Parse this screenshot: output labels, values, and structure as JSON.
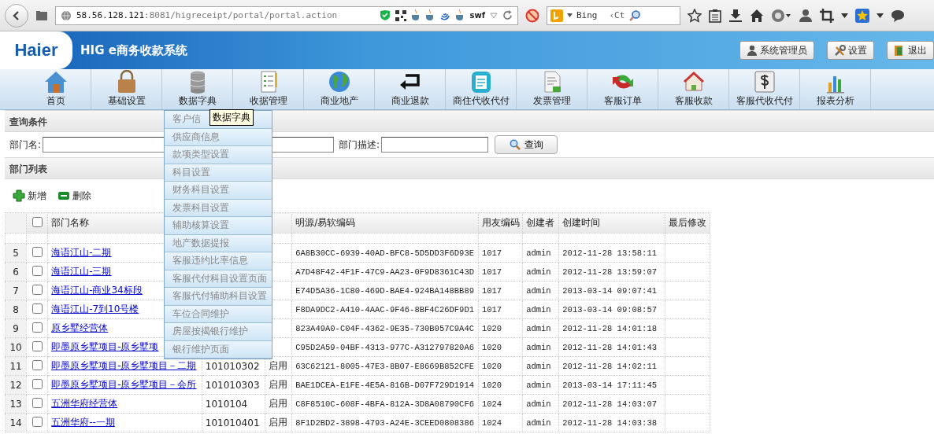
{
  "browser": {
    "url_host": "58.56.128.121",
    "url_path": ":8081/higreceipt/portal/portal.action",
    "extension_label": "swf",
    "search_engine": "Bing",
    "search_value": "‹Ct"
  },
  "header": {
    "logo": "Haier",
    "title": "HIG e商务收款系统",
    "buttons": [
      {
        "label": "系统管理员",
        "kind": "user"
      },
      {
        "label": "设置",
        "kind": "tools"
      },
      {
        "label": "退出",
        "kind": "exit"
      }
    ]
  },
  "nav": [
    {
      "label": "首页",
      "kind": "house"
    },
    {
      "label": "基础设置",
      "kind": "lock"
    },
    {
      "label": "数据字典",
      "kind": "database"
    },
    {
      "label": "收据管理",
      "kind": "checklist"
    },
    {
      "label": "商业地产",
      "kind": "globe"
    },
    {
      "label": "商业退款",
      "kind": "return"
    },
    {
      "label": "商住代收代付",
      "kind": "clipboard"
    },
    {
      "label": "发票管理",
      "kind": "invoice"
    },
    {
      "label": "客服订单",
      "kind": "arrow"
    },
    {
      "label": "客服收款",
      "kind": "houses"
    },
    {
      "label": "客服代收代付",
      "kind": "dollar"
    },
    {
      "label": "报表分析",
      "kind": "chart"
    }
  ],
  "query": {
    "title": "查询条件",
    "fields": [
      {
        "label": "部门名:"
      },
      {
        "label": "部门描述:"
      }
    ],
    "button": "查询"
  },
  "list": {
    "title": "部门列表",
    "actions": [
      {
        "label": "新增",
        "kind": "add"
      },
      {
        "label": "删除",
        "kind": "remove"
      }
    ]
  },
  "table": {
    "select_all_checked": false,
    "columns": [
      "部门名称",
      null,
      null,
      "明源/易软编码",
      "用友编码",
      "创建者",
      "创建时间",
      "最后修改"
    ],
    "rows": [
      {
        "index": "5",
        "checked": false,
        "cells": [
          "海语江山-二期",
          null,
          null,
          "6A8B30CC-6939-40AD-BFC8-5D5DD3F6D93E",
          "1017",
          "admin",
          "2012-11-28 13:58:11"
        ]
      },
      {
        "index": "6",
        "checked": false,
        "cells": [
          "海语江山-三期",
          null,
          null,
          "A7D48F42-4F1F-47C9-AA23-0F9D8361C43D",
          "1017",
          "admin",
          "2012-11-28 13:59:07"
        ]
      },
      {
        "index": "7",
        "checked": false,
        "cells": [
          "海语江山-商业34标段",
          null,
          null,
          "E74D5A36-1C80-469D-BAE4-924BA148BB89",
          "1017",
          "admin",
          "2013-03-14 09:07:41"
        ]
      },
      {
        "index": "8",
        "checked": false,
        "cells": [
          "海语江山-7到10号楼",
          null,
          null,
          "F8DA9DC2-A410-4AAC-9F46-8BF4C26DF9D1",
          "1017",
          "admin",
          "2013-03-14 09:08:57"
        ]
      },
      {
        "index": "9",
        "checked": false,
        "cells": [
          "原乡墅经营体",
          null,
          null,
          "823A49A0-C04F-4362-9E35-730B057C9A4C",
          "1020",
          "admin",
          "2012-11-28 14:01:18"
        ]
      },
      {
        "index": "10",
        "checked": false,
        "cells": [
          "即墨原乡墅项目-原乡墅项",
          null,
          null,
          "C95D2A59-04BF-4313-977C-A312797820A6",
          "1020",
          "admin",
          "2012-11-28 14:01:43"
        ]
      },
      {
        "index": "11",
        "checked": false,
        "cells": [
          "即墨原乡墅项目-原乡墅项目－二期",
          "101010302",
          "启用",
          "63C62121-8005-47E3-8B07-E8669B852CFE",
          "1020",
          "admin",
          "2012-11-28 14:02:11"
        ]
      },
      {
        "index": "12",
        "checked": false,
        "cells": [
          "即墨原乡墅项目-原乡墅项目－会所",
          "101010303",
          "启用",
          "BAE1DCEA-E1FE-4E5A-816B-D07F729D1914",
          "1020",
          "admin",
          "2013-03-14 17:11:45"
        ]
      },
      {
        "index": "13",
        "checked": false,
        "cells": [
          "五洲华府经营体",
          "1010104",
          "启用",
          "C8F8510C-608F-4BFA-812A-3D8A08790CF6",
          "1024",
          "admin",
          "2012-11-28 14:03:07"
        ]
      },
      {
        "index": "14",
        "checked": false,
        "cells": [
          "五洲华府--一期",
          "101010401",
          "启用",
          "8F1D2BD2-3898-4793-A24E-3CEED0808386",
          "1024",
          "admin",
          "2012-11-28 14:03:38"
        ]
      }
    ]
  },
  "dropdown": {
    "items": [
      "客户信",
      "供应商信息",
      "款项类型设置",
      "科目设置",
      "财务科目设置",
      "发票科目设置",
      "辅助核算设置",
      "地产数据提报",
      "客服违约比率信息",
      "客服代付科目设置页面",
      "客服代付辅助科目设置",
      "车位合同维护",
      "房屋按揭银行维护",
      "银行维护页面"
    ],
    "tooltip": "数据字典"
  }
}
